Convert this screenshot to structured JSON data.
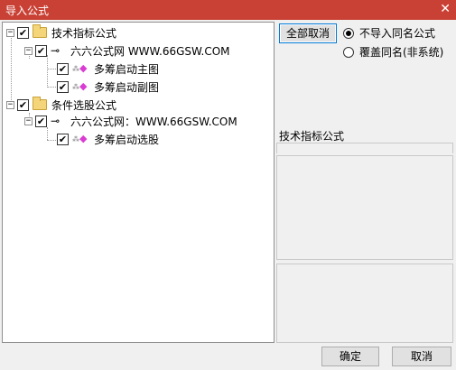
{
  "window": {
    "title": "导入公式",
    "close_glyph": "✕"
  },
  "tree": {
    "groups": [
      {
        "label": "技术指标公式",
        "checked": true,
        "expander": "−",
        "source": {
          "label": "六六公式网 WWW.66GSW.COM",
          "checked": true,
          "expander": "−",
          "items": [
            {
              "label": "多筹启动主图",
              "checked": true
            },
            {
              "label": "多筹启动副图",
              "checked": true
            }
          ]
        }
      },
      {
        "label": "条件选股公式",
        "checked": true,
        "expander": "−",
        "source": {
          "label": "六六公式网：WWW.66GSW.COM",
          "checked": true,
          "expander": "−",
          "items": [
            {
              "label": "多筹启动选股",
              "checked": true
            }
          ]
        }
      }
    ],
    "check_glyph": "✔",
    "key_glyph": "⊸",
    "gem_prefix": "⁂",
    "gem_glyph": "◆"
  },
  "right": {
    "deselect_all_label": "全部取消",
    "option_no_import_label": "不导入同名公式",
    "option_overwrite_label": "覆盖同名(非系统)",
    "selected_option": "no_import",
    "info_label": "技术指标公式"
  },
  "footer": {
    "ok_label": "确定",
    "cancel_label": "取消"
  },
  "colors": {
    "title_bar": "#c94135",
    "gem": "#d93bd3",
    "folder": "#f5d57a"
  }
}
